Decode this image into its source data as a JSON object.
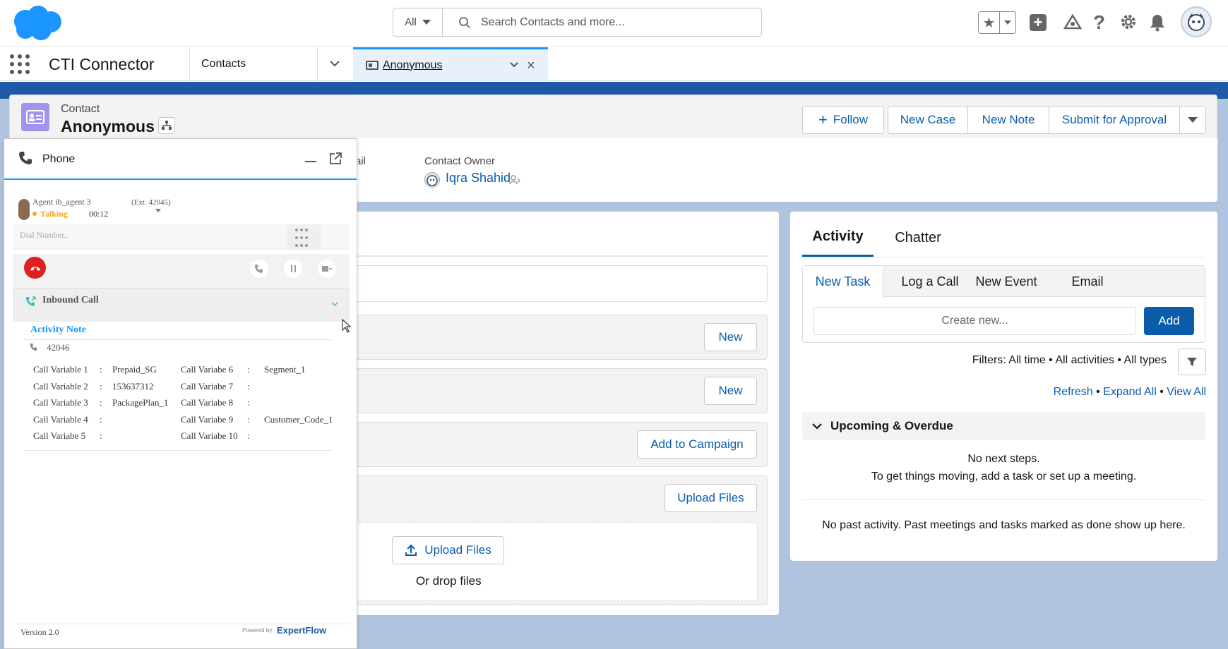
{
  "header": {
    "search_scope": "All",
    "search_placeholder": "Search Contacts and more..."
  },
  "nav": {
    "app_name": "CTI Connector",
    "tabs": [
      {
        "label": "Contacts"
      },
      {
        "label": "Anonymous"
      }
    ]
  },
  "record": {
    "object_label": "Contact",
    "name": "Anonymous",
    "actions": {
      "follow": "Follow",
      "new_case": "New Case",
      "new_note": "New Note",
      "submit": "Submit for Approval"
    },
    "fields": {
      "email_partial": "ail",
      "owner_label": "Contact Owner",
      "owner_name": "Iqra Shahid"
    }
  },
  "related": {
    "new1": "New",
    "new2": "New",
    "add_to_campaign": "Add to Campaign",
    "upload_files": "Upload Files",
    "upload_files_drop": "Upload Files",
    "or_drop_files": "Or drop files"
  },
  "activity": {
    "tabs": [
      "Activity",
      "Chatter"
    ],
    "subtabs": [
      "New Task",
      "Log a Call",
      "New Event",
      "Email"
    ],
    "create_placeholder": "Create new...",
    "add_label": "Add",
    "filters": "Filters: All time • All activities • All types",
    "links": [
      "Refresh",
      "Expand All",
      "View All"
    ],
    "section_title": "Upcoming & Overdue",
    "no_next": "No next steps.",
    "no_next_hint": "To get things moving, add a task or set up a meeting.",
    "no_past": "No past activity. Past meetings and tasks marked as done show up here."
  },
  "phone": {
    "title": "Phone",
    "agent_name": "Agent ib_agent 3",
    "status": "Talking",
    "timer": "00:12",
    "extension": "(Ext. 42045)",
    "dial_placeholder": "Dial Number..",
    "inbound_label": "Inbound Call",
    "activity_note": "Activity Note",
    "caller_number": "42046",
    "variables": [
      {
        "label": "Call Variable 1",
        "value": "Prepaid_SG"
      },
      {
        "label": "Call Variable 2",
        "value": "153637312"
      },
      {
        "label": "Call Variable 3",
        "value": "PackagePlan_1"
      },
      {
        "label": "Call Variable 4",
        "value": ""
      },
      {
        "label": "Call Variabe 5",
        "value": ""
      }
    ],
    "variables_right": [
      {
        "label": "Call Variabe 6",
        "value": "Segment_1"
      },
      {
        "label": "Call Variabe 7",
        "value": ""
      },
      {
        "label": "Call Variabe 8",
        "value": ""
      },
      {
        "label": "Call Variabe 9",
        "value": "Customer_Code_1"
      },
      {
        "label": "Call Variabe 10",
        "value": ""
      }
    ],
    "version": "Version 2.0",
    "powered_by": "Powered by",
    "brand": "ExpertFlow"
  },
  "colors": {
    "salesforce_blue": "#1b96ff",
    "link": "#0b5cab",
    "end_call_red": "#e02020",
    "talking": "#f5a623",
    "page_bg": "#b0c4df",
    "banner": "#1e5aa8"
  }
}
